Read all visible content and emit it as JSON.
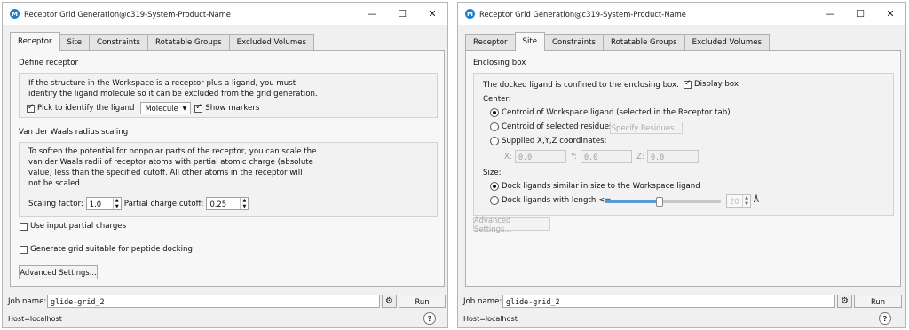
{
  "window_title": "Receptor Grid Generation@c319-System-Product-Name",
  "window_controls": {
    "minimize": "—",
    "maximize": "☐",
    "close": "✕"
  },
  "app_icon_letter": "M",
  "tabs": [
    "Receptor",
    "Site",
    "Constraints",
    "Rotatable Groups",
    "Excluded Volumes"
  ],
  "receptor_tab": {
    "define_receptor_title": "Define receptor",
    "define_text_line1": "If the structure in the Workspace is a receptor plus a ligand, you must",
    "define_text_line2": "identify the ligand molecule so it can be excluded from the grid generation.",
    "pick_label": "Pick to identify the ligand",
    "pick_checked": true,
    "pick_mode": "Molecule",
    "show_markers_label": "Show markers",
    "show_markers_checked": true,
    "vdw_title": "Van der Waals radius scaling",
    "vdw_text_line1": "To soften the potential for nonpolar parts of the receptor, you can scale the",
    "vdw_text_line2": "van der Waals radii of receptor atoms with partial atomic charge (absolute",
    "vdw_text_line3": "value) less than the specified cutoff.  All other atoms in the receptor will",
    "vdw_text_line4": "not be scaled.",
    "scaling_label": "Scaling factor:",
    "scaling_value": "1.0",
    "cutoff_label": "Partial charge cutoff:",
    "cutoff_value": "0.25",
    "input_charges_label": "Use input partial charges",
    "input_charges_checked": false,
    "peptide_label": "Generate grid suitable for peptide docking",
    "peptide_checked": false,
    "advanced_button": "Advanced Settings..."
  },
  "site_tab": {
    "enclosing_title": "Enclosing box",
    "confined_text": "The docked ligand is confined to the enclosing box.",
    "display_box_label": "Display box",
    "display_box_checked": true,
    "center_label": "Center:",
    "center_options": [
      "Centroid of Workspace ligand (selected in the Receptor tab)",
      "Centroid of selected residues:",
      "Supplied X,Y,Z coordinates:"
    ],
    "center_selected": 0,
    "specify_residues_button": "Specify Residues...",
    "x_label": "X:",
    "x_value": "0.0",
    "y_label": "Y:",
    "y_value": "0.0",
    "z_label": "Z:",
    "z_value": "0.0",
    "size_label": "Size:",
    "size_options": [
      "Dock ligands similar in size to the Workspace ligand",
      "Dock ligands with length <="
    ],
    "size_selected": 0,
    "length_value": "20",
    "length_slider_fraction": 0.47,
    "length_unit": "Å",
    "advanced_button": "Advanced Settings..."
  },
  "footer": {
    "job_name_label": "Job name:",
    "job_name_value": "glide-grid_2",
    "run_button": "Run",
    "host_label": "Host=localhost",
    "help_glyph": "?"
  }
}
